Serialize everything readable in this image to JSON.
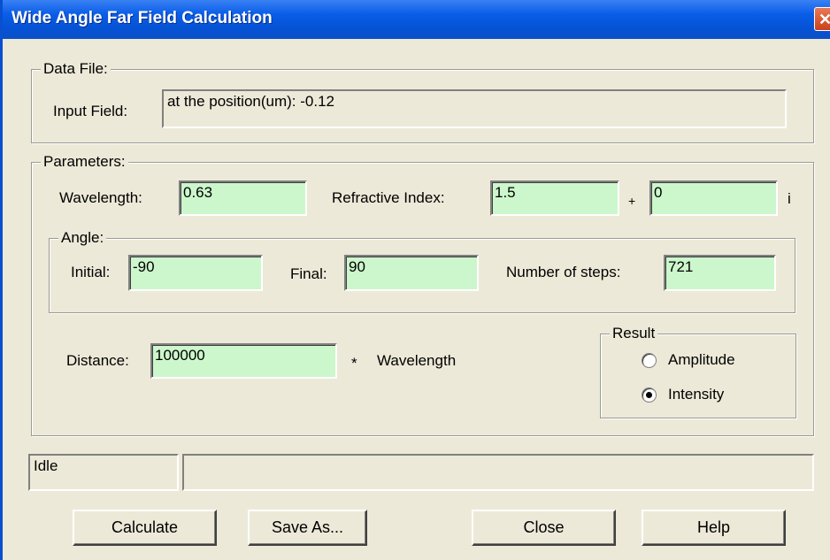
{
  "window": {
    "title": "Wide Angle Far Field Calculation",
    "close_glyph": "✕"
  },
  "data_file": {
    "legend": "Data File:",
    "input_field_label": "Input Field:",
    "input_field_value": "at the position(um): -0.12"
  },
  "parameters": {
    "legend": "Parameters:",
    "wavelength_label": "Wavelength:",
    "wavelength_value": "0.63",
    "refractive_index_label": "Refractive Index:",
    "refractive_index_real": "1.5",
    "plus_sign": "+",
    "refractive_index_imag": "0",
    "imag_unit": "i",
    "angle": {
      "legend": "Angle:",
      "initial_label": "Initial:",
      "initial_value": "-90",
      "final_label": "Final:",
      "final_value": "90",
      "steps_label": "Number of steps:",
      "steps_value": "721"
    },
    "distance_label": "Distance:",
    "distance_value": "100000",
    "times_sign": "*",
    "distance_unit": "Wavelength",
    "result": {
      "legend": "Result",
      "options": [
        {
          "label": "Amplitude",
          "selected": false
        },
        {
          "label": "Intensity",
          "selected": true
        }
      ]
    }
  },
  "status": {
    "text": "Idle",
    "message": ""
  },
  "buttons": {
    "calculate": "Calculate",
    "save_as": "Save As...",
    "close": "Close",
    "help": "Help"
  }
}
